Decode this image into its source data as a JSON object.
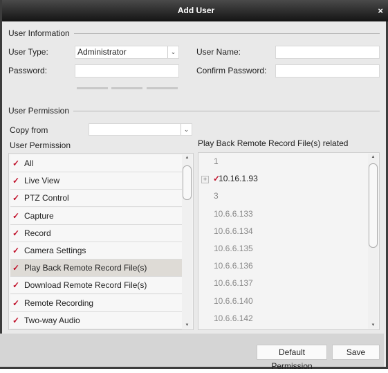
{
  "title": "Add User",
  "close_icon": "×",
  "user_info": {
    "section": "User Information",
    "user_type_label": "User Type:",
    "user_type_value": "Administrator",
    "user_name_label": "User Name:",
    "user_name_value": "",
    "password_label": "Password:",
    "password_value": "",
    "confirm_label": "Confirm Password:",
    "confirm_value": ""
  },
  "permission": {
    "section": "User Permission",
    "copy_from_label": "Copy from",
    "copy_from_value": "",
    "list_label": "User Permission",
    "items": [
      {
        "label": "All",
        "checked": true
      },
      {
        "label": "Live View",
        "checked": true
      },
      {
        "label": "PTZ Control",
        "checked": true
      },
      {
        "label": "Capture",
        "checked": true
      },
      {
        "label": "Record",
        "checked": true
      },
      {
        "label": "Camera Settings",
        "checked": true
      },
      {
        "label": "Play Back Remote Record File(s)",
        "checked": true,
        "selected": true
      },
      {
        "label": "Download Remote Record File(s)",
        "checked": true
      },
      {
        "label": "Remote Recording",
        "checked": true
      },
      {
        "label": "Two-way Audio",
        "checked": true
      }
    ],
    "related_label": "Play Back Remote Record File(s) related",
    "devices": [
      {
        "label": "1"
      },
      {
        "label": "10.16.1.93",
        "checked": true,
        "expandable": true
      },
      {
        "label": "3"
      },
      {
        "label": "10.6.6.133"
      },
      {
        "label": "10.6.6.134"
      },
      {
        "label": "10.6.6.135"
      },
      {
        "label": "10.6.6.136"
      },
      {
        "label": "10.6.6.137"
      },
      {
        "label": "10.6.6.140"
      },
      {
        "label": "10.6.6.142"
      }
    ]
  },
  "buttons": {
    "default": "Default Permission",
    "save": "Save"
  },
  "colors": {
    "check": "#c0102a",
    "titlebar": "#1e1e1e",
    "selected_row": "#dedbd6"
  }
}
